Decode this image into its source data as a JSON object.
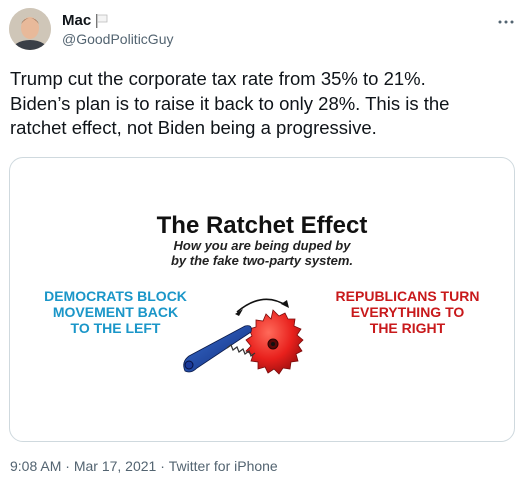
{
  "author": {
    "display_name": "Mac",
    "handle": "@GoodPoliticGuy",
    "avatar_icon": "avatar-photo",
    "badge_icon": "white-flag-icon"
  },
  "tweet": {
    "text": "Trump cut the corporate tax rate from 35% to 21%.\nBiden’s plan is to raise it back to only 28%. This is the\nratchet effect, not Biden being a progressive.",
    "more_icon": "more-options-icon"
  },
  "media": {
    "title": "The Ratchet Effect",
    "subtitle_line1": "How you are being duped by",
    "subtitle_line2": "by the fake two-party system.",
    "left_caption": "DEMOCRATS BLOCK\nMOVEMENT BACK\nTO THE LEFT",
    "right_caption": "REPUBLICANS TURN\nEVERYTHING TO\nTHE RIGHT",
    "colors": {
      "left": "#1a96c8",
      "right": "#c8191b"
    }
  },
  "meta": {
    "time": "9:08 AM",
    "date": "Mar 17, 2021",
    "source": "Twitter for iPhone",
    "separator": " · "
  }
}
